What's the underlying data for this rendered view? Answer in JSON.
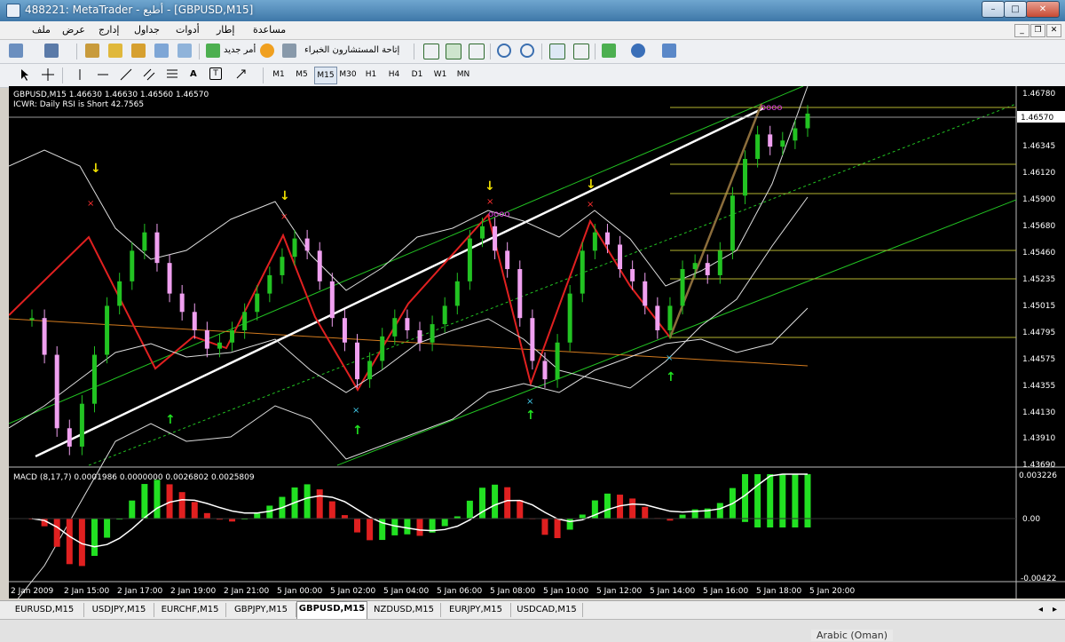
{
  "window": {
    "title": "488221: MetaTrader - أطبع - [GBPUSD,M15]",
    "min": "–",
    "max": "□",
    "close": "✕"
  },
  "menu": [
    "ملف",
    "عرض",
    "إدارج",
    "جداول",
    "أدوات",
    "إطار",
    "مساعدة"
  ],
  "toolbar": {
    "new_order_label": "أمر جديد",
    "experts_label": "إتاحة المستشارون الخبراء",
    "timeframes": [
      "M1",
      "M5",
      "M15",
      "M30",
      "H1",
      "H4",
      "D1",
      "W1",
      "MN"
    ],
    "active_timeframe": "M15",
    "line_tools": [
      "T"
    ]
  },
  "chart": {
    "header_line1": "GBPUSD,M15  1.46630 1.46630 1.46560 1.46570",
    "header_line2": "ICWR: Daily RSI is Short 42.7565",
    "current_price": "1.46570",
    "macd_label": "MACD  (8,17,7) 0.0001986 0.0000000 0.0026802 0.0025809",
    "price_ticks": [
      "1.46780",
      "1.46570",
      "1.46345",
      "1.46120",
      "1.45900",
      "1.45680",
      "1.45460",
      "1.45235",
      "1.45015",
      "1.44795",
      "1.44575",
      "1.44355",
      "1.44130",
      "1.43910",
      "1.43690"
    ],
    "macd_ticks": [
      "0.003226",
      "0.00",
      "-0.00422"
    ],
    "time_ticks": [
      "2 Jan 2009",
      "2 Jan 15:00",
      "2 Jan 17:00",
      "2 Jan 19:00",
      "2 Jan 21:00",
      "5 Jan 00:00",
      "5 Jan 02:00",
      "5 Jan 04:00",
      "5 Jan 06:00",
      "5 Jan 08:00",
      "5 Jan 10:00",
      "5 Jan 12:00",
      "5 Jan 14:00",
      "5 Jan 16:00",
      "5 Jan 18:00",
      "5 Jan 20:00"
    ]
  },
  "chart_data": {
    "type": "line",
    "symbol": "GBPUSD",
    "timeframe": "M15",
    "close": [
      1.449,
      1.446,
      1.44,
      1.4385,
      1.442,
      1.446,
      1.45,
      1.452,
      1.4545,
      1.456,
      1.4535,
      1.451,
      1.4495,
      1.448,
      1.4465,
      1.447,
      1.448,
      1.4495,
      1.451,
      1.4525,
      1.454,
      1.4555,
      1.4545,
      1.452,
      1.449,
      1.447,
      1.444,
      1.4455,
      1.4475,
      1.449,
      1.448,
      1.447,
      1.4485,
      1.45,
      1.452,
      1.4555,
      1.4565,
      1.4545,
      1.453,
      1.449,
      1.4455,
      1.444,
      1.447,
      1.451,
      1.4545,
      1.456,
      1.455,
      1.453,
      1.452,
      1.45,
      1.448,
      1.45,
      1.453,
      1.4535,
      1.4525,
      1.4545,
      1.459,
      1.462,
      1.464,
      1.463,
      1.4635,
      1.4645,
      1.4657
    ],
    "ylim": [
      1.4369,
      1.4678
    ],
    "current_price": 1.4657,
    "macd": {
      "params": "8,17,7",
      "main": 0.0001986,
      "signal": 0.0025809
    },
    "macd_ylim": [
      -0.00422,
      0.003226
    ]
  },
  "tabs": [
    "EURUSD,M15",
    "USDJPY,M15",
    "EURCHF,M15",
    "GBPJPY,M15",
    "GBPUSD,M15",
    "NZDUSD,M15",
    "EURJPY,M15",
    "USDCAD,M15"
  ],
  "active_tab": "GBPUSD,M15",
  "status": {
    "language": "Arabic (Oman)"
  }
}
